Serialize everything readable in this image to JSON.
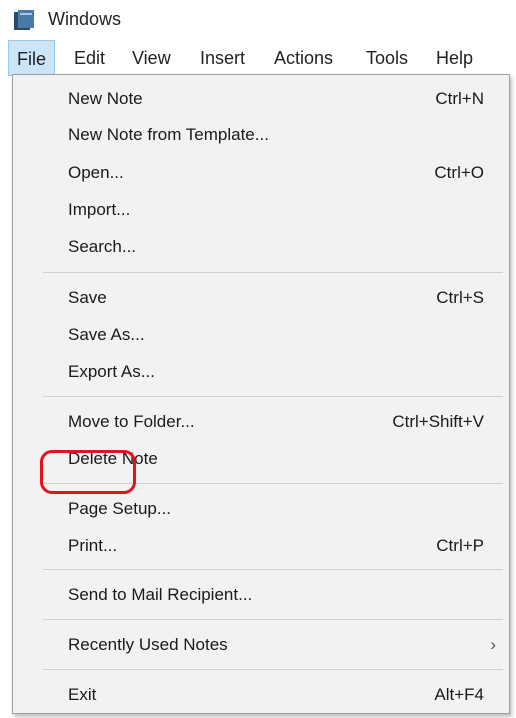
{
  "window": {
    "title": "Windows",
    "icon": "app-book-icon"
  },
  "menubar": {
    "items": [
      {
        "label": "File",
        "active": true
      },
      {
        "label": "Edit"
      },
      {
        "label": "View"
      },
      {
        "label": "Insert"
      },
      {
        "label": "Actions"
      },
      {
        "label": "Tools"
      },
      {
        "label": "Help"
      }
    ]
  },
  "file_menu": {
    "items": [
      {
        "label": "New Note",
        "shortcut": "Ctrl+N"
      },
      {
        "label": "New Note from Template...",
        "shortcut": ""
      },
      {
        "label": "Open...",
        "shortcut": "Ctrl+O"
      },
      {
        "label": "Import...",
        "shortcut": ""
      },
      {
        "label": "Search...",
        "shortcut": ""
      },
      {
        "label": "Save",
        "shortcut": "Ctrl+S"
      },
      {
        "label": "Save As...",
        "shortcut": ""
      },
      {
        "label": "Export As...",
        "shortcut": ""
      },
      {
        "label": "Move to Folder...",
        "shortcut": "Ctrl+Shift+V"
      },
      {
        "label": "Delete Note",
        "shortcut": ""
      },
      {
        "label": "Page Setup...",
        "shortcut": ""
      },
      {
        "label": "Print...",
        "shortcut": "Ctrl+P",
        "highlighted": true
      },
      {
        "label": "Send to Mail Recipient...",
        "shortcut": ""
      },
      {
        "label": "Recently Used Notes",
        "shortcut": "",
        "submenu_arrow": "›"
      },
      {
        "label": "Exit",
        "shortcut": "Alt+F4"
      }
    ]
  },
  "colors": {
    "highlight_ring": "#e0141c",
    "menu_background": "#f2f2f2",
    "active_menubar": "#cce4f7"
  }
}
